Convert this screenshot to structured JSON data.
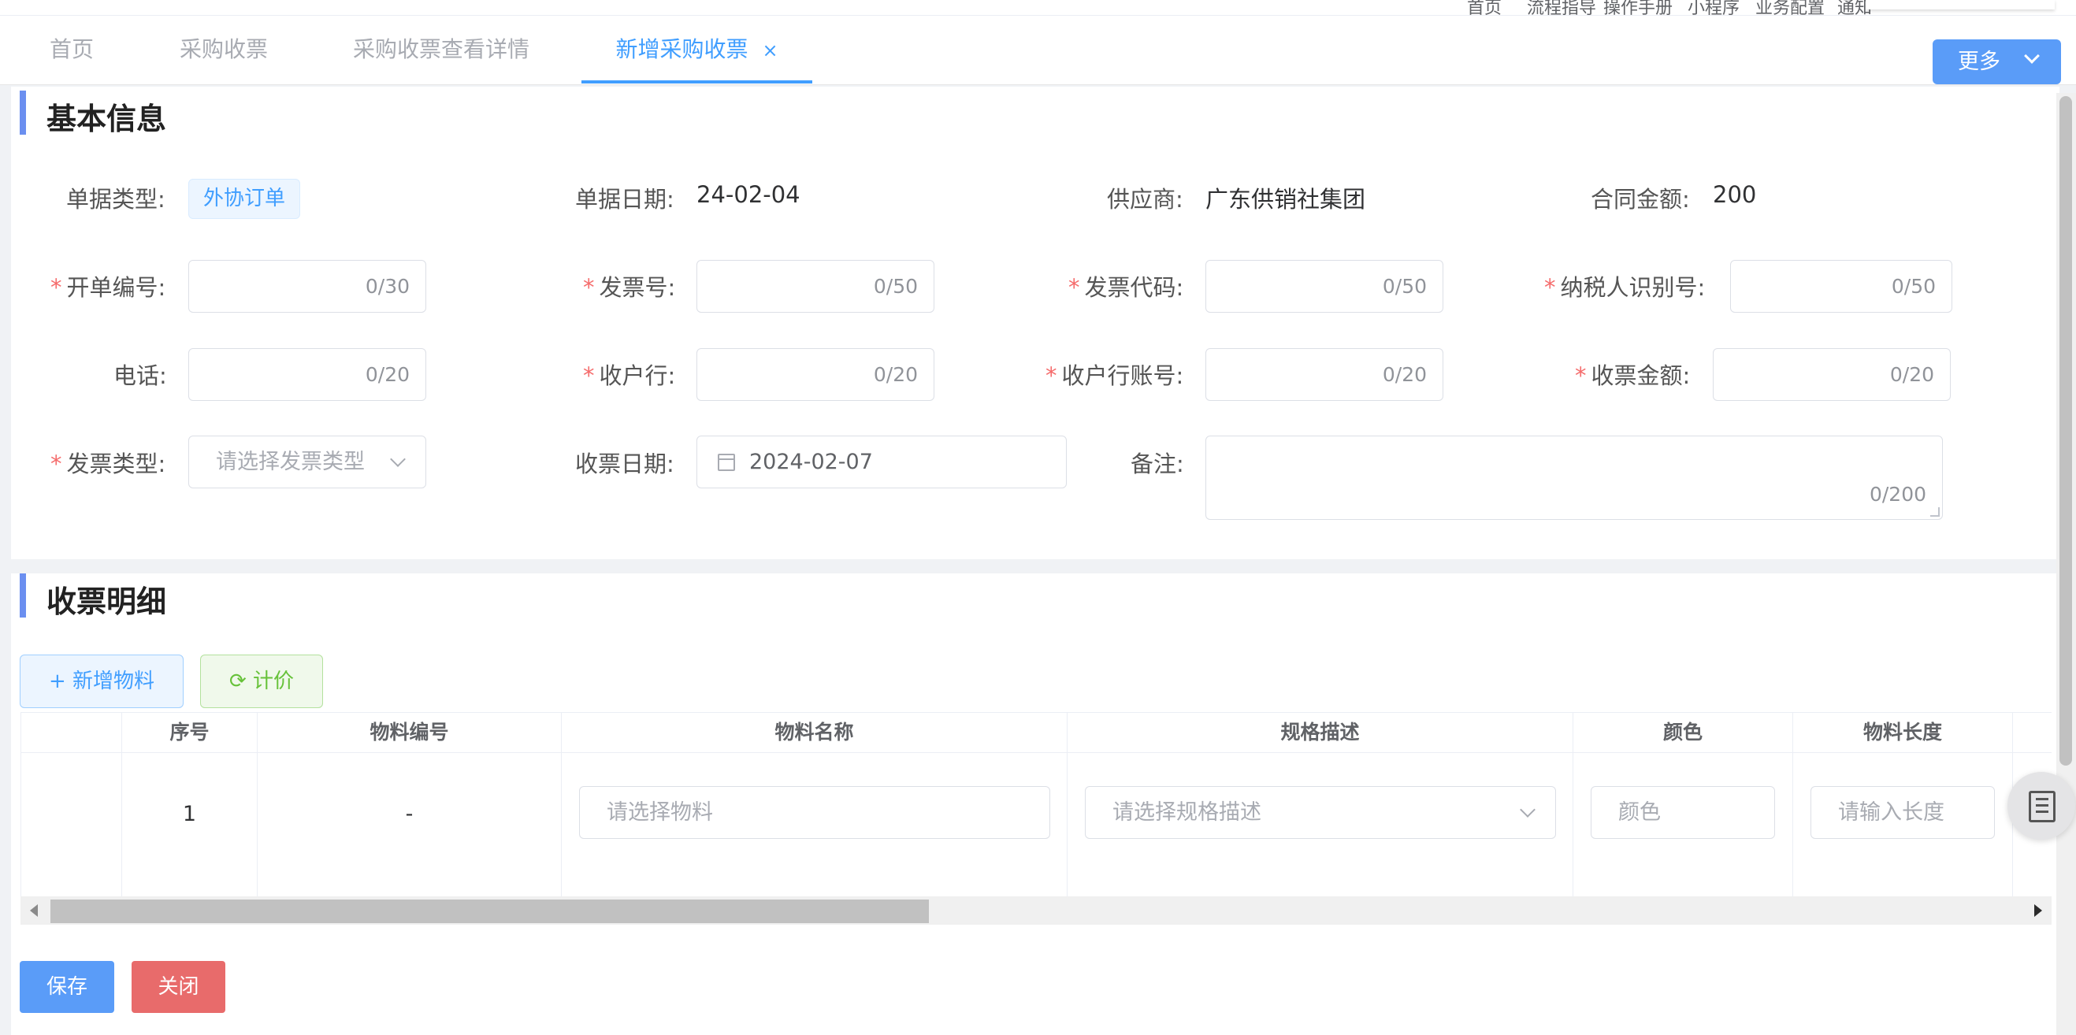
{
  "topbar": {
    "links": [
      {
        "label": "首页"
      },
      {
        "label": "流程指导"
      },
      {
        "label": "操作手册"
      },
      {
        "label": "小程序"
      },
      {
        "label": "业务配置"
      },
      {
        "label": "通知"
      }
    ]
  },
  "tabs": [
    {
      "label": "首页"
    },
    {
      "label": "采购收票"
    },
    {
      "label": "采购收票查看详情"
    },
    {
      "label": "新增采购收票",
      "close": "×"
    }
  ],
  "more_button": "更多",
  "basic_info": {
    "title": "基本信息",
    "doc_type_label": "单据类型:",
    "doc_type_value": "外协订单",
    "doc_date_label": "单据日期:",
    "doc_date_value": "24-02-04",
    "supplier_label": "供应商:",
    "supplier_value": "广东供销社集团",
    "contract_amount_label": "合同金额:",
    "contract_amount_value": "200",
    "billing_no_label": "开单编号:",
    "billing_no_count": "0/30",
    "invoice_no_label": "发票号:",
    "invoice_no_count": "0/50",
    "invoice_code_label": "发票代码:",
    "invoice_code_count": "0/50",
    "taxpayer_id_label": "纳税人识别号:",
    "taxpayer_id_count": "0/50",
    "phone_label": "电话:",
    "phone_count": "0/20",
    "bank_label": "收户行:",
    "bank_count": "0/20",
    "bank_account_label": "收户行账号:",
    "bank_account_count": "0/20",
    "receipt_amount_label": "收票金额:",
    "receipt_amount_count": "0/20",
    "invoice_type_label": "发票类型:",
    "invoice_type_placeholder": "请选择发票类型",
    "receipt_date_label": "收票日期:",
    "receipt_date_value": "2024-02-07",
    "remark_label": "备注:",
    "remark_count": "0/200",
    "required_mark": "*"
  },
  "detail": {
    "title": "收票明细",
    "add_material_label": "新增物料",
    "price_label": "计价",
    "columns": {
      "seq": "序号",
      "material_code": "物料编号",
      "material_name": "物料名称",
      "spec": "规格描述",
      "color": "颜色",
      "length": "物料长度"
    },
    "rows": [
      {
        "seq": "1",
        "material_code": "-",
        "material_name_placeholder": "请选择物料",
        "spec_placeholder": "请选择规格描述",
        "color_placeholder": "颜色",
        "length_placeholder": "请输入长度"
      }
    ]
  },
  "footer": {
    "save_label": "保存",
    "close_label": "关闭"
  },
  "colors": {
    "primary": "#409eff",
    "section_bar": "#6b8ff0",
    "danger": "#e86b6b",
    "success": "#67c23a",
    "required": "#f56c6c"
  }
}
